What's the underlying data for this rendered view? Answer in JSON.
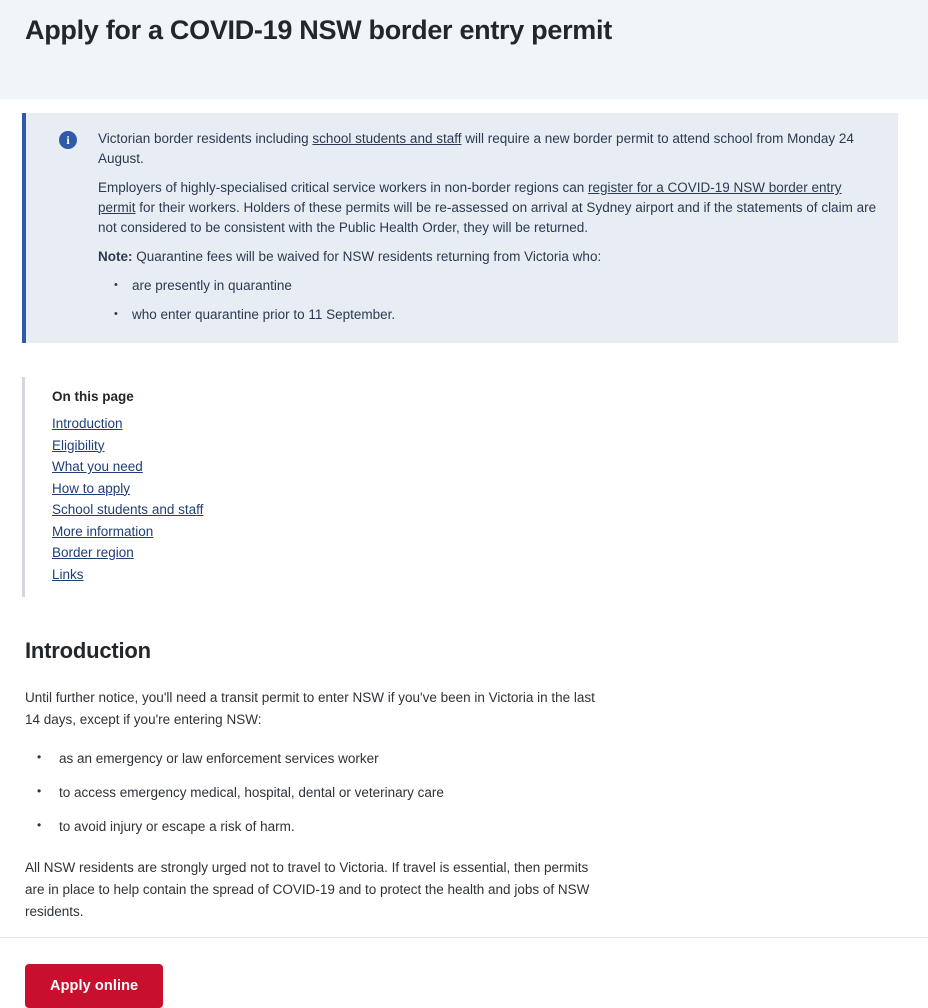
{
  "header": {
    "title": "Apply for a COVID-19 NSW border entry permit",
    "background_color": "#f1f5f9"
  },
  "callout": {
    "icon_name": "info-icon",
    "icon_glyph": "i",
    "accent_color": "#2e5aa8",
    "background_color": "#e8edf3",
    "paragraph_1": {
      "before_link": "Victorian border residents including ",
      "link_text": "school students and staff",
      "after_link": " will require a new border permit to attend school from Monday 24 August."
    },
    "paragraph_2": {
      "before_link": "Employers of highly-specialised critical service workers in non-border regions can ",
      "link_text": "register for a COVID-19 NSW border entry permit",
      "after_link": " for their workers. Holders of these permits will be re-assessed on arrival at Sydney airport and if the statements of claim are not considered to be consistent with the Public Health Order, they will be returned."
    },
    "note_label": "Note:",
    "note_text": " Quarantine fees will be waived for NSW residents returning from Victoria who:",
    "note_items": [
      "are presently in quarantine",
      "who enter quarantine prior to 11 September."
    ]
  },
  "on_this_page": {
    "title": "On this page",
    "links": [
      "Introduction",
      "Eligibility",
      "What you need",
      "How to apply",
      "School students and staff",
      "More information",
      "Border region",
      "Links"
    ]
  },
  "introduction": {
    "heading": "Introduction",
    "paragraph_1": "Until further notice, you'll need a transit permit to enter NSW if you've been in Victoria in the last 14 days, except if you're entering NSW:",
    "bullets": [
      "as an emergency or law enforcement services worker",
      "to access emergency medical, hospital, dental or veterinary care",
      "to avoid injury or escape a risk of harm."
    ],
    "paragraph_2": "All NSW residents are strongly urged not to travel to Victoria. If travel is essential, then permits are in place to help contain the spread of COVID-19 and to protect the health and jobs of NSW residents."
  },
  "cta": {
    "apply_label": "Apply online",
    "button_color": "#c8102e"
  }
}
